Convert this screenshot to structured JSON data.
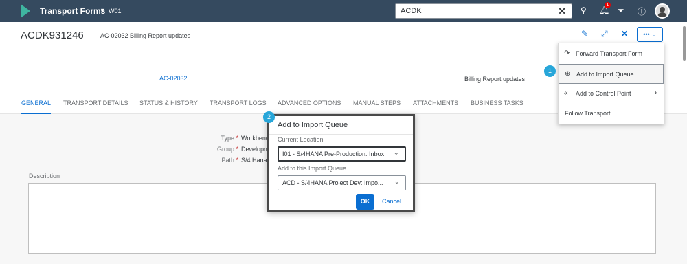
{
  "shell": {
    "app_title": "Transport Forms",
    "system": "W01",
    "search_value": "ACDK",
    "notification_count": "1"
  },
  "header": {
    "object_id": "ACDK931246",
    "object_description": "AC-02032 Billing Report updates",
    "reference_link": "AC-02032",
    "reference_text": "Billing Report updates"
  },
  "tabs": [
    {
      "label": "GENERAL"
    },
    {
      "label": "TRANSPORT DETAILS"
    },
    {
      "label": "STATUS & HISTORY"
    },
    {
      "label": "TRANSPORT LOGS"
    },
    {
      "label": "ADVANCED OPTIONS"
    },
    {
      "label": "MANUAL STEPS"
    },
    {
      "label": "ATTACHMENTS"
    },
    {
      "label": "BUSINESS TASKS"
    }
  ],
  "fields": {
    "type_label": "Type:",
    "type_value": "Workbenc",
    "group_label": "Group:",
    "group_value": "Developm",
    "path_label": "Path:",
    "path_value": "S/4 Hana",
    "required_mark": "*"
  },
  "description_label": "Description",
  "menu": {
    "items": [
      {
        "label": "Forward Transport Form",
        "icon": "forward-arrow-icon"
      },
      {
        "label": "Add to Import Queue",
        "icon": "add-circle-icon"
      },
      {
        "label": "Add to Control Point",
        "icon": "rewind-circle-icon"
      },
      {
        "label": "Follow Transport"
      }
    ]
  },
  "dialog": {
    "title": "Add to Import Queue",
    "current_location_label": "Current Location",
    "current_location_value": "I01 - S/4HANA Pre-Production: Inbox",
    "import_queue_label": "Add to this Import Queue",
    "import_queue_value": "ACD - S/4HANA Project Dev: Impo...",
    "ok_label": "OK",
    "cancel_label": "Cancel"
  },
  "steps": {
    "step1": "1",
    "step2": "2"
  },
  "colors": {
    "shell": "#354a5f",
    "accent": "#0a6ed1",
    "step_marker": "#27a6d9"
  }
}
